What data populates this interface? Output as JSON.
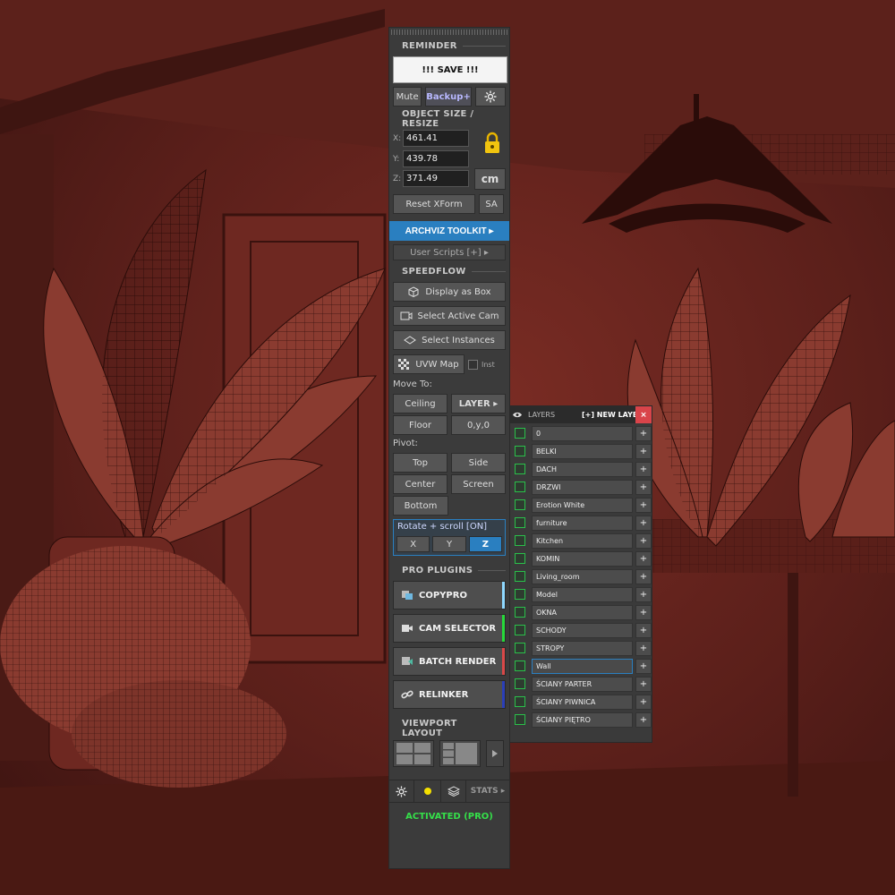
{
  "reminder": {
    "section": "REMINDER",
    "save": "!!! SAVE !!!",
    "mute": "Mute",
    "backup": "Backup+"
  },
  "size": {
    "section": "OBJECT SIZE / RESIZE",
    "x_label": "X:",
    "x": "461.41",
    "y_label": "Y:",
    "y": "439.78",
    "z_label": "Z:",
    "z": "371.49",
    "unit": "cm",
    "reset": "Reset XForm",
    "sa": "SA"
  },
  "archviz": "ARCHVIZ TOOLKIT ▸",
  "user_scripts": "User Scripts [+] ▸",
  "speedflow": {
    "section": "SPEEDFLOW",
    "display_box": "Display as Box",
    "active_cam": "Select Active Cam",
    "instances": "Select Instances",
    "uvw": "UVW Map",
    "inst": "Inst"
  },
  "move": {
    "label": "Move To:",
    "ceiling": "Ceiling",
    "layer": "LAYER ▸",
    "floor": "Floor",
    "zero": "0,y,0"
  },
  "pivot": {
    "label": "Pivot:",
    "top": "Top",
    "side": "Side",
    "center": "Center",
    "screen": "Screen",
    "bottom": "Bottom"
  },
  "rotate": {
    "text": "Rotate + scroll  [ON]",
    "x": "X",
    "y": "Y",
    "z": "Z",
    "active": "Z"
  },
  "pro": {
    "section": "PRO PLUGINS",
    "items": [
      {
        "label": "COPYPRO",
        "color": "#8fd8ff"
      },
      {
        "label": "CAM SELECTOR",
        "color": "#27d83a"
      },
      {
        "label": "BATCH RENDER",
        "color": "#d84848"
      },
      {
        "label": "RELINKER",
        "color": "#2b3fb8"
      }
    ]
  },
  "viewport": {
    "section": "VIEWPORT LAYOUT"
  },
  "bottom": {
    "stats": "STATS ▸",
    "status": "ACTIVATED (PRO)"
  },
  "layers": {
    "title": "LAYERS",
    "new_layer": "[+] NEW LAYER",
    "close": "×",
    "plus": "+",
    "selected": "Wall",
    "items": [
      "0",
      "BELKI",
      "DACH",
      "DRZWI",
      "Erotion White",
      "furniture",
      "Kitchen",
      "KOMIN",
      "Living_room",
      "Model",
      "OKNA",
      "SCHODY",
      "STROPY",
      "Wall",
      "ŚCIANY PARTER",
      "ŚCIANY PIWNICA",
      "ŚCIANY PIĘTRO"
    ]
  },
  "colors": {
    "accent": "#2a7fc0",
    "activated": "#35e04a",
    "close": "#d9444a",
    "scene": "#6b261f"
  }
}
